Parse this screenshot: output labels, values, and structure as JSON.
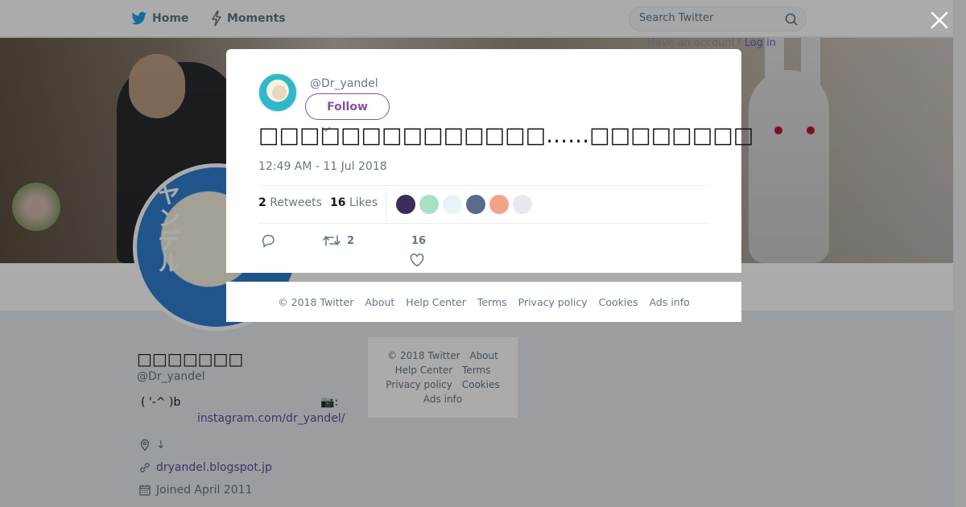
{
  "topbar": {
    "home_label": "Home",
    "moments_label": "Moments",
    "search_placeholder": "Search Twitter",
    "login_hint_prefix": "Have an account?",
    "login_link": "Log in"
  },
  "profile": {
    "name": "□□□□□□□",
    "handle": "@Dr_yandel",
    "bio": "( '-^ )b",
    "camera_glyph": "📷:",
    "instagram": "instagram.com/dr_yandel/",
    "location": "↓",
    "website": "dryandel.blogspot.jp",
    "joined": "Joined April 2011"
  },
  "side_footer": {
    "links": [
      "© 2018 Twitter",
      "About",
      "Help Center",
      "Terms",
      "Privacy policy",
      "Cookies",
      "Ads info"
    ]
  },
  "tweet": {
    "handle": "@Dr_yandel",
    "follow_label": "Follow",
    "text": "□□□□□□□□□□□□□□……□□□□□□□□",
    "time": "12:49 AM - 11 Jul 2018",
    "retweets_count": "2",
    "retweets_label": "Retweets",
    "likes_count": "16",
    "likes_label": "Likes",
    "action_retweet_count": "2",
    "action_like_count": "16",
    "likers": [
      {
        "color": "#3b2c5a"
      },
      {
        "color": "#a8e0c6"
      },
      {
        "color": "#e8f3f8"
      },
      {
        "color": "#5a6a8c"
      },
      {
        "color": "#f2a48a"
      },
      {
        "color": "#e9e7ef"
      }
    ]
  },
  "modal_footer": {
    "links": [
      "© 2018 Twitter",
      "About",
      "Help Center",
      "Terms",
      "Privacy policy",
      "Cookies",
      "Ads info"
    ]
  },
  "colors": {
    "accent": "#8b4fa4",
    "link": "#5b4e9a",
    "muted": "#657786"
  }
}
